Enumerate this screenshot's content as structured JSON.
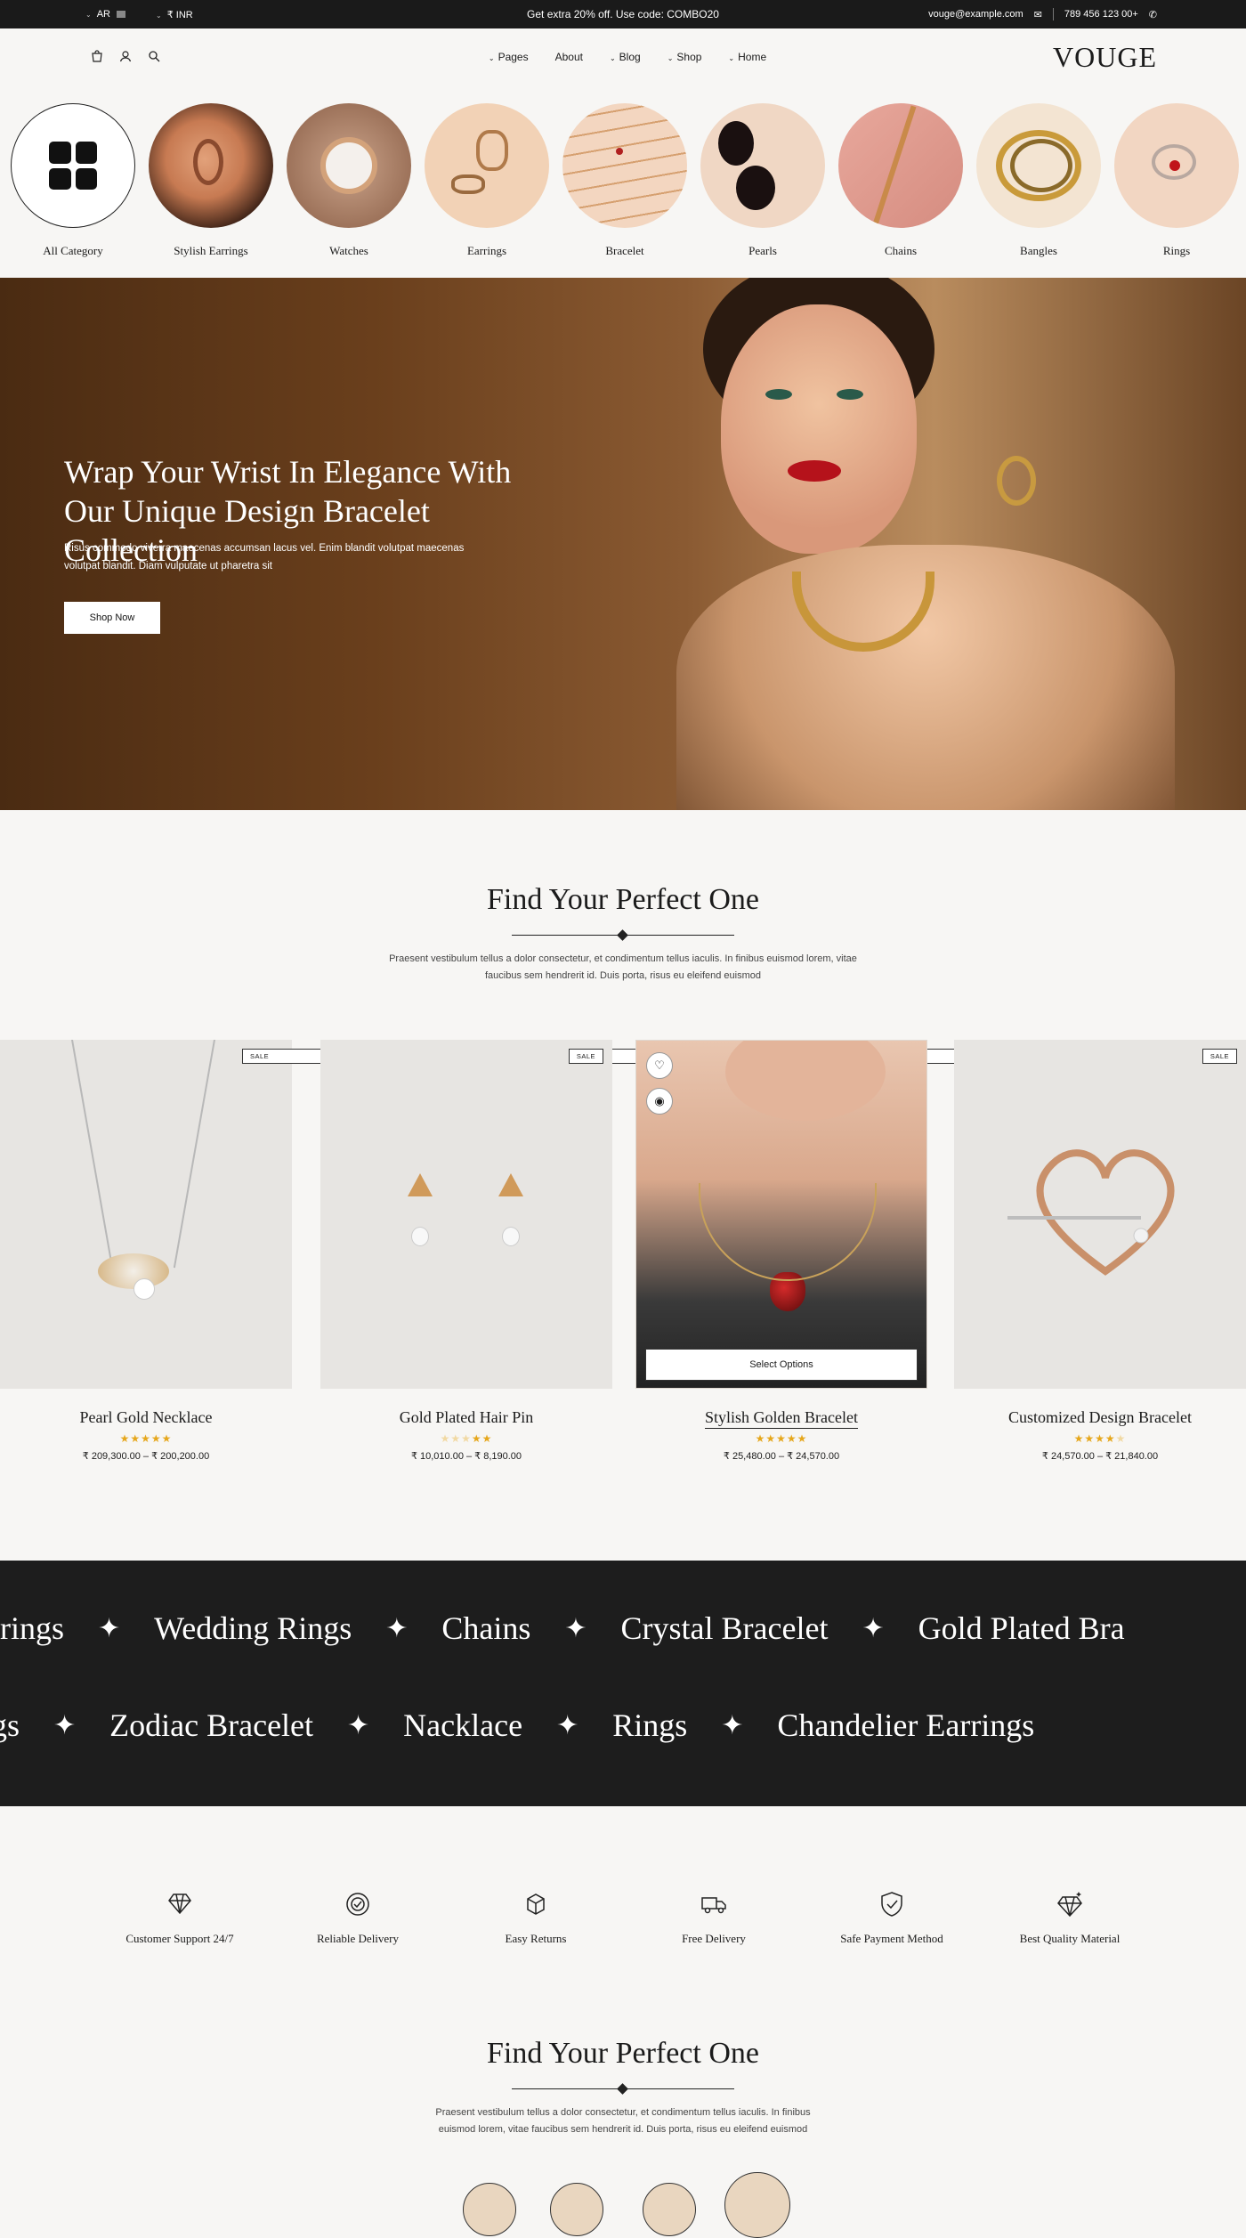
{
  "topbar": {
    "language": "AR",
    "currency": "₹ INR",
    "promo": "Get extra 20% off. Use code: COMBO20",
    "email": "vouge@example.com",
    "phone": "789 456 123 00+"
  },
  "header": {
    "nav": [
      "Pages",
      "About",
      "Blog",
      "Shop",
      "Home"
    ],
    "logo": "VOUGE"
  },
  "categories": [
    "All Category",
    "Stylish Earrings",
    "Watches",
    "Earrings",
    "Bracelet",
    "Pearls",
    "Chains",
    "Bangles",
    "Rings"
  ],
  "hero": {
    "title": "Wrap Your Wrist In Elegance With Our Unique Design Bracelet Collection",
    "text": "Risus commodo viverra maecenas accumsan lacus vel. Enim blandit volutpat maecenas volutpat blandit. Diam vulputate ut pharetra sit",
    "button": "Shop Now"
  },
  "section1": {
    "title": "Find Your Perfect One",
    "text": "Praesent vestibulum tellus a dolor consectetur, et condimentum tellus iaculis. In finibus euismod lorem, vitae faucibus sem hendrerit id. Duis porta, risus eu eleifend euismod"
  },
  "products": [
    {
      "name": "Pearl Gold Necklace",
      "price": "₹ 209,300.00 – ₹ 200,200.00",
      "badge": "SALE",
      "rating": 5
    },
    {
      "name": "Gold Plated Hair Pin",
      "price": "₹ 10,010.00 – ₹ 8,190.00",
      "badge": "SALE",
      "rating": 2
    },
    {
      "name": "Stylish Golden Bracelet",
      "price": "₹ 25,480.00 – ₹ 24,570.00",
      "button": "Select Options",
      "rating": 5
    },
    {
      "name": "Customized Design Bracelet",
      "price": "₹ 24,570.00 – ₹ 21,840.00",
      "badge": "SALE",
      "rating": 4
    }
  ],
  "marquee": {
    "row1": [
      "rrings",
      "Wedding Rings",
      "Chains",
      "Crystal Bracelet",
      "Gold Plated Bra"
    ],
    "row2": [
      "gs",
      "Zodiac Bracelet",
      "Nacklace",
      "Rings",
      "Chandelier Earrings"
    ]
  },
  "features": [
    "Customer Support 24/7",
    "Reliable Delivery",
    "Easy Returns",
    "Free Delivery",
    "Safe Payment Method",
    "Best Quality Material"
  ],
  "section2": {
    "title": "Find Your Perfect One",
    "text": "Praesent vestibulum tellus a dolor consectetur, et condimentum tellus iaculis. In finibus euismod lorem, vitae faucibus sem hendrerit id. Duis porta, risus eu eleifend euismod"
  },
  "colors": {
    "accent": "#1a1a1a",
    "star": "#e6a71c",
    "background": "#f7f6f4"
  }
}
